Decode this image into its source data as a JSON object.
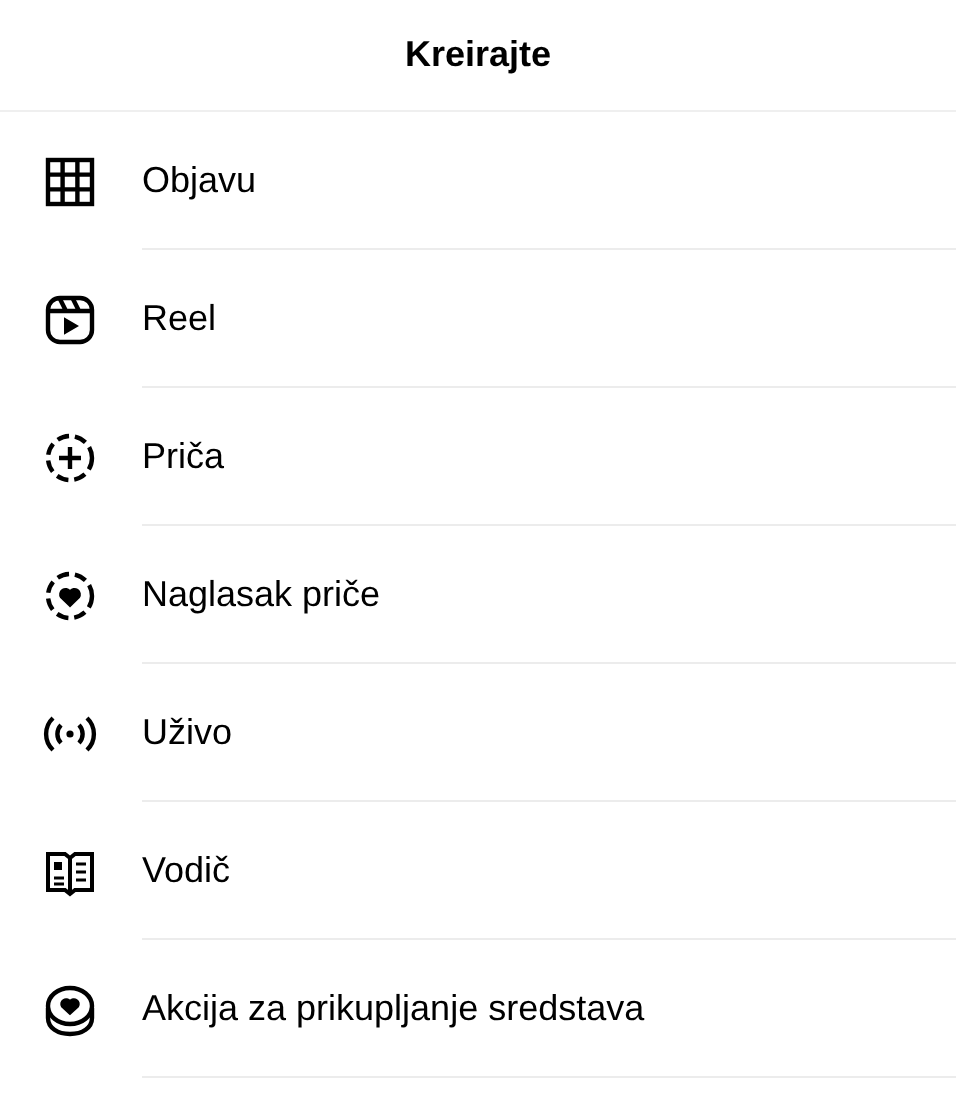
{
  "header": {
    "title": "Kreirajte"
  },
  "items": [
    {
      "kind": "grid",
      "label": "Objavu"
    },
    {
      "kind": "reel",
      "label": "Reel"
    },
    {
      "kind": "story",
      "label": "Priča"
    },
    {
      "kind": "highlight",
      "label": "Naglasak priče"
    },
    {
      "kind": "live",
      "label": "Uživo"
    },
    {
      "kind": "guide",
      "label": "Vodič"
    },
    {
      "kind": "fundraiser",
      "label": "Akcija za prikupljanje sredstava"
    }
  ]
}
